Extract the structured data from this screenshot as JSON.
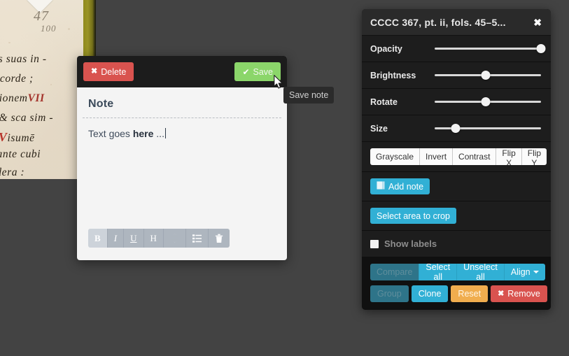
{
  "canvas": {
    "background_color": "#434343"
  },
  "manuscript": {
    "folio_number": "47",
    "folio_subnumber": "100",
    "lines": [
      "uccas suas in -",
      "recu corde ;",
      "a uisionem",
      "rubric VII",
      "irtis & sca sim -",
      "atq; visume",
      "uod ante cubi",
      "adsidera :"
    ],
    "edge_color": "#8f8a1c"
  },
  "note_popup": {
    "delete_label": "Delete",
    "delete_icon": "close-icon",
    "delete_color": "#d9534f",
    "save_label": "Save",
    "save_icon": "check-icon",
    "save_color": "#8bd66a",
    "title": "Note",
    "body_text_before": "Text goes ",
    "body_text_bold": "here",
    "body_text_after": " ...",
    "toolbar": [
      {
        "name": "bold-button",
        "glyph": "B",
        "active": true
      },
      {
        "name": "italic-button",
        "glyph": "I",
        "active": false
      },
      {
        "name": "underline-button",
        "glyph": "U",
        "active": false
      },
      {
        "name": "heading-button",
        "glyph": "H",
        "active": false
      },
      {
        "name": "link-globe-button",
        "glyph": "⊕",
        "active": false
      },
      {
        "name": "list-button",
        "glyph": "☰",
        "active": false
      },
      {
        "name": "trash-button",
        "glyph": "Ὕ1",
        "active": false
      }
    ]
  },
  "tooltip": {
    "text": "Save note"
  },
  "panel": {
    "title": "CCCC 367, pt. ii, fols. 45–5...",
    "close_icon": "close-icon",
    "sliders": [
      {
        "label": "Opacity",
        "value": 100,
        "percent": 100
      },
      {
        "label": "Brightness",
        "value": 50,
        "percent": 48
      },
      {
        "label": "Rotate",
        "value": 50,
        "percent": 48
      },
      {
        "label": "Size",
        "value": 20,
        "percent": 20
      }
    ],
    "filters": [
      "Grayscale",
      "Invert",
      "Contrast",
      "Flip X",
      "Flip Y"
    ],
    "add_note": {
      "label": "Add note",
      "icon": "note-icon",
      "color": "#31b0d5"
    },
    "select_crop": {
      "label": "Select area to crop",
      "color": "#31b0d5"
    },
    "show_labels": {
      "label": "Show labels",
      "checked": false
    },
    "segmented": [
      {
        "label": "Compare",
        "disabled": true
      },
      {
        "label": "Select all",
        "disabled": false
      },
      {
        "label": "Unselect all",
        "disabled": false
      },
      {
        "label": "Align",
        "disabled": false,
        "caret": true
      }
    ],
    "bottom_buttons": [
      {
        "label": "Group",
        "style": "group",
        "color": "#2e7489",
        "disabled": true
      },
      {
        "label": "Clone",
        "style": "clone",
        "color": "#31b0d5",
        "disabled": false
      },
      {
        "label": "Reset",
        "style": "reset",
        "color": "#f0ad4e",
        "disabled": false
      },
      {
        "label": "Remove",
        "style": "remove",
        "color": "#d9534f",
        "disabled": false,
        "icon": "close-icon"
      }
    ]
  }
}
